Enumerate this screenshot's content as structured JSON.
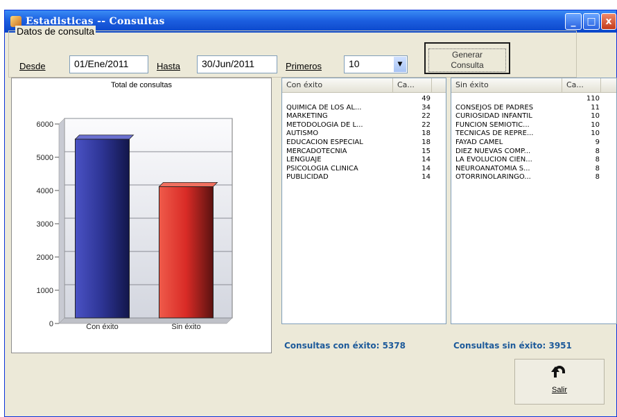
{
  "window": {
    "title": "Estadisticas -- Consultas",
    "buttons": {
      "minimize": "_",
      "maximize": "□",
      "close": "x"
    }
  },
  "form": {
    "group_label": "Datos de consulta",
    "desde_label": "Desde",
    "desde_value": "01/Ene/2011",
    "hasta_label": "Hasta",
    "hasta_value": "30/Jun/2011",
    "primeros_label": "Primeros",
    "primeros_value": "10",
    "generar_button": [
      "Generar",
      "Consulta"
    ]
  },
  "chart_data": {
    "type": "bar",
    "title": "Total de consultas",
    "categories": [
      "Con éxito",
      "Sin éxito"
    ],
    "values": [
      5378,
      3951
    ],
    "colors": [
      "#2d3494",
      "#d92b26"
    ],
    "ylim": [
      0,
      6000
    ],
    "yticks": [
      0,
      1000,
      2000,
      3000,
      4000,
      5000,
      6000
    ],
    "grid": true
  },
  "lists": {
    "success": {
      "col_name": "Con éxito",
      "col_count": "Ca...",
      "rows": [
        {
          "name": "",
          "count": "49"
        },
        {
          "name": "QUIMICA DE LOS AL...",
          "count": "34"
        },
        {
          "name": "MARKETING",
          "count": "22"
        },
        {
          "name": "METODOLOGÍA DE L...",
          "count": "22"
        },
        {
          "name": "AUTISMO",
          "count": "18"
        },
        {
          "name": "EDUCACION ESPECIAL",
          "count": "18"
        },
        {
          "name": "MERCADOTECNIA",
          "count": "15"
        },
        {
          "name": "LENGUAJE",
          "count": "14"
        },
        {
          "name": "PSICOLOGIA CLINICA",
          "count": "14"
        },
        {
          "name": "PUBLICIDAD",
          "count": "14"
        }
      ]
    },
    "failure": {
      "col_name": "Sin éxito",
      "col_count": "Ca...",
      "rows": [
        {
          "name": "",
          "count": "110"
        },
        {
          "name": "CONSEJOS DE PADRES",
          "count": "11"
        },
        {
          "name": "CURIOSIDAD INFANTIL",
          "count": "10"
        },
        {
          "name": "FUNCION SEMIOTIC...",
          "count": "10"
        },
        {
          "name": "TECNICAS DE REPRE...",
          "count": "10"
        },
        {
          "name": "FAYAD CAMEL",
          "count": "9"
        },
        {
          "name": "DIEZ NUEVAS COMP...",
          "count": "8"
        },
        {
          "name": "LA EVOLUCION CIEN...",
          "count": "8"
        },
        {
          "name": "NEUROANATOMIA S...",
          "count": "8"
        },
        {
          "name": "OTORRINOLARINGO...",
          "count": "8"
        }
      ]
    }
  },
  "summary": {
    "success_text": "Consultas con éxito: 5378",
    "failure_text": "Consultas sin éxito: 3951"
  },
  "exit_button": {
    "label": "Salir"
  }
}
